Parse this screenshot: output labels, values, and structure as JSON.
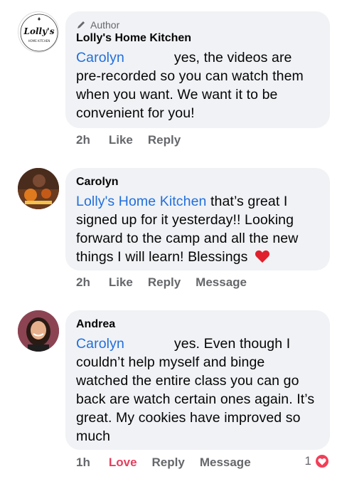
{
  "comments": [
    {
      "author_badge": "Author",
      "name": "Lolly's Home Kitchen",
      "mention": "Carolyn",
      "text": "yes, the videos are pre-recorded so you can watch them when you want. We want it to be convenient for you!",
      "time": "2h",
      "actions": [
        "Like",
        "Reply"
      ],
      "avatar_logo": "Lolly's",
      "avatar_sub": "HOME KITCHEN"
    },
    {
      "name": "Carolyn",
      "mention": "Lolly's Home Kitchen",
      "text": "that’s great I signed up for it yesterday!! Looking forward to the camp and all the new things I will learn! Blessings",
      "emoji": "red-heart",
      "time": "2h",
      "actions": [
        "Like",
        "Reply",
        "Message"
      ]
    },
    {
      "name": "Andrea",
      "mention": "Carolyn",
      "text": "yes. Even though I couldn’t help myself and binge watched the entire class you can go back are watch certain ones again. It’s great. My cookies have improved so much",
      "time": "1h",
      "actions": [
        "Love",
        "Reply",
        "Message"
      ],
      "reaction_count": "1",
      "reaction_icon": "heart-reaction-icon"
    }
  ],
  "colors": {
    "mention": "#216fdb",
    "bubble": "#f0f2f5",
    "meta": "#65676b",
    "love": "#e4405f",
    "heart": "#f33e58"
  }
}
